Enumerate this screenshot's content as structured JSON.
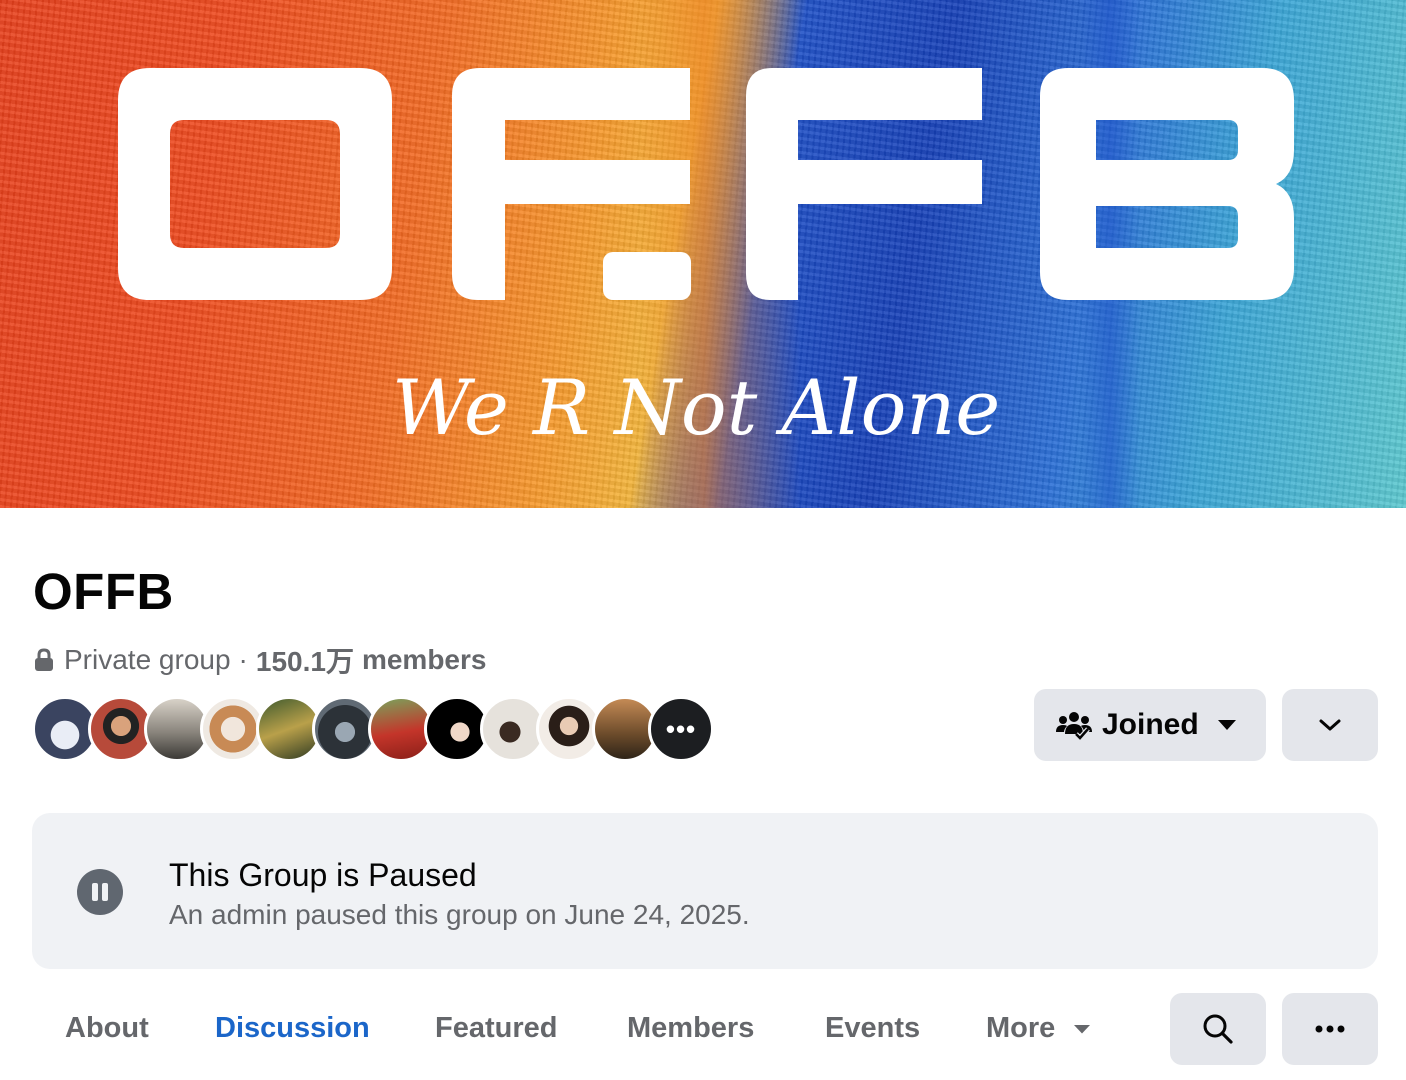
{
  "cover": {
    "logo_text": "OFFB",
    "tagline": "We R Not Alone"
  },
  "group": {
    "name": "OFFB",
    "privacy": "Private group",
    "separator": "·",
    "member_count": "150.1万",
    "member_label": "members"
  },
  "avatars": {
    "more_label": "•••"
  },
  "actions": {
    "joined_label": "Joined"
  },
  "paused_banner": {
    "title": "This Group is Paused",
    "subtitle": "An admin paused this group on June 24, 2025."
  },
  "tabs": {
    "items": [
      {
        "label": "About"
      },
      {
        "label": "Discussion",
        "active": true
      },
      {
        "label": "Featured"
      },
      {
        "label": "Members"
      },
      {
        "label": "Events"
      },
      {
        "label": "More"
      }
    ]
  },
  "colors": {
    "accent": "#1b66c9",
    "button_bg": "#e4e6eb",
    "banner_bg": "#f0f2f5",
    "secondary_text": "#65676b"
  }
}
